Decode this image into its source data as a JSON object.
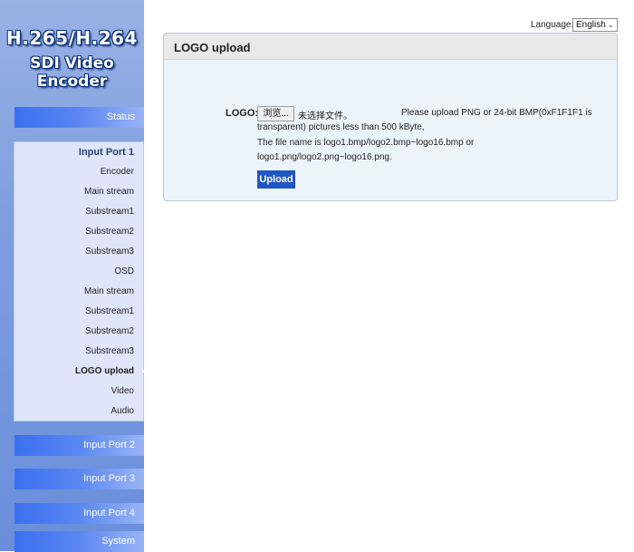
{
  "brand": {
    "line1": "H.265/H.264",
    "line2": "SDI Video Encoder"
  },
  "nav": {
    "status": "Status",
    "input_port_1": "Input Port 1",
    "input_port_1_items": [
      "Encoder",
      "Main stream",
      "Substream1",
      "Substream2",
      "Substream3",
      "OSD",
      "Main stream",
      "Substream1",
      "Substream2",
      "Substream3",
      "LOGO upload",
      "Video",
      "Audio"
    ],
    "active_item": "LOGO upload",
    "input_port_2": "Input Port 2",
    "input_port_3": "Input Port 3",
    "input_port_4": "Input Port 4",
    "system": "System"
  },
  "language": {
    "label": "Language:",
    "value": "English"
  },
  "panel": {
    "title": "LOGO upload",
    "logo_label": "LOGO:",
    "browse_button": "浏览...",
    "no_file": "未选择文件。",
    "note_lines": [
      "Please upload PNG or 24-bit BMP(0xF1F1F1 is",
      "transparent) pictures less than 500 kByte,",
      "The file name is logo1.bmp/logo2.bmp~logo16.bmp or",
      "logo1.png/logo2.png~logo16.png."
    ],
    "upload_button": "Upload"
  },
  "colors": {
    "nav_button": "#3a6ff0",
    "upload_button": "#1f56c4",
    "panel_bg": "#ecf4fb"
  }
}
